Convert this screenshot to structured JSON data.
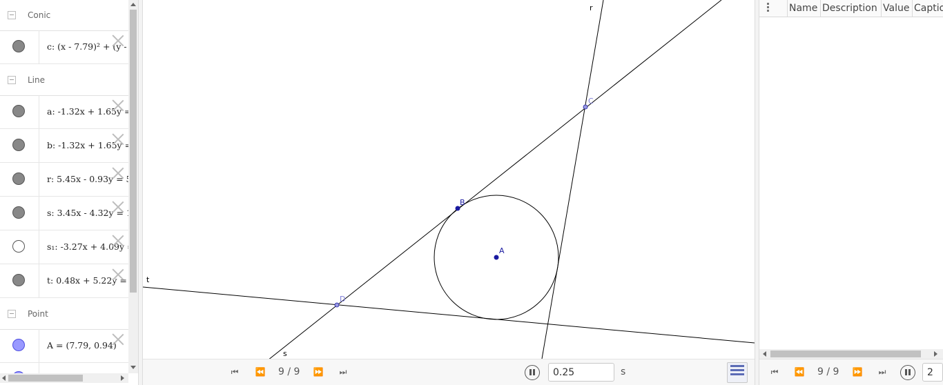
{
  "algebra": {
    "groups": [
      {
        "label": "Conic"
      },
      {
        "label": "Line"
      },
      {
        "label": "Point"
      }
    ],
    "items": [
      {
        "text": "c: (x - 7.79)² + (y -",
        "marble": "shown"
      },
      {
        "text": "a: -1.32x + 1.65y =",
        "marble": "shown"
      },
      {
        "text": "b: -1.32x + 1.65y =",
        "marble": "shown"
      },
      {
        "text": "r: 5.45x - 0.93y = 5",
        "marble": "shown"
      },
      {
        "text": "s: 3.45x - 4.32y = 1",
        "marble": "shown"
      },
      {
        "text": "s₁: -3.27x + 4.09y =",
        "marble": "hidden"
      },
      {
        "text": "t: 0.48x + 5.22y =",
        "marble": "shown"
      },
      {
        "text": "A = (7.79, 0.94)",
        "marble": "point"
      }
    ]
  },
  "graphics": {
    "labels": {
      "r": "r",
      "t": "t",
      "s": "s",
      "A": "A",
      "B": "B",
      "C": "C",
      "D": "D"
    },
    "colors": {
      "point": "#1a1aa0",
      "point_light": "#7b7bd6",
      "line": "#000000"
    }
  },
  "playback": {
    "step": "9 / 9",
    "speed": "0.25",
    "unit": "s"
  },
  "protocol": {
    "columns": [
      "Name",
      "Description",
      "Value",
      "Caption"
    ],
    "step": "9 / 9",
    "field": "2"
  }
}
